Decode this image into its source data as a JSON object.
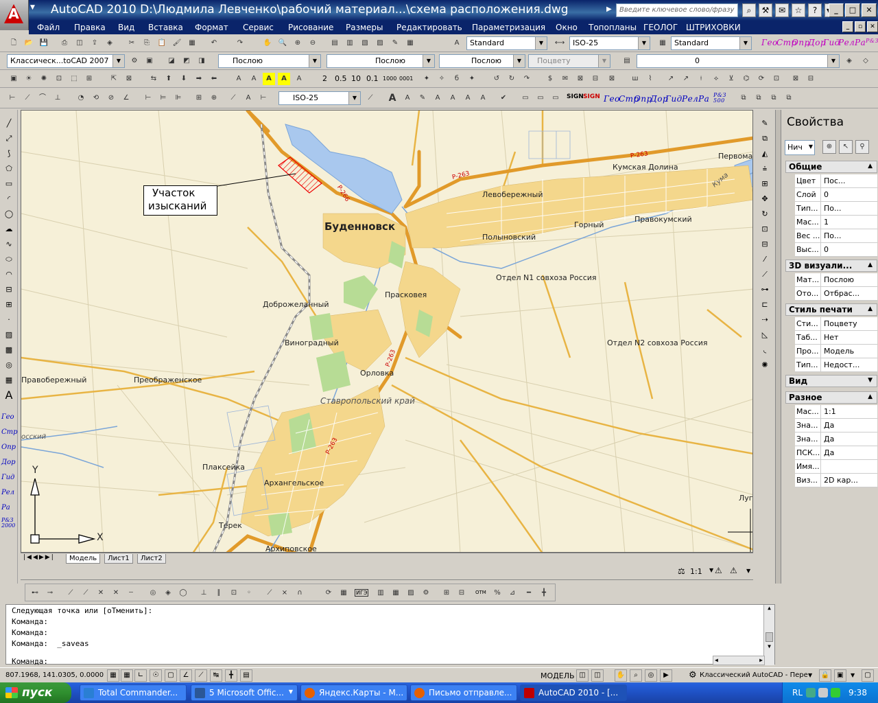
{
  "window": {
    "title": "AutoCAD 2010   D:\\Людмила Левченко\\рабочий материал...\\схема расположения.dwg",
    "search_placeholder": "Введите ключевое слово/фразу"
  },
  "menu": [
    "Файл",
    "Правка",
    "Вид",
    "Вставка",
    "Формат",
    "Сервис",
    "Рисование",
    "Размеры",
    "Редактировать",
    "Параметризация",
    "Окно",
    "Топопланы",
    "ГЕОЛОГ",
    "ШТРИХОВКИ"
  ],
  "toolbar_styles": {
    "text_style": "Standard",
    "dim_style": "ISO-25",
    "table_style": "Standard",
    "geo_labels": [
      "Гео",
      "Стр",
      "Опр",
      "Дор",
      "Гид",
      "Рел",
      "Ра",
      "Р&З"
    ]
  },
  "toolbar_props": {
    "workspace": "Классическ...toCAD 2007",
    "color": "Послою",
    "linetype": "Послою",
    "lineweight": "Послою",
    "plotstyle": "Поцвету",
    "layer": "0"
  },
  "toolbar_dims": {
    "dim_style": "ISO-25",
    "scales": [
      "2",
      "0.5",
      "10",
      "0.1",
      "1000",
      "0001"
    ],
    "sign_labels": [
      "SIGN",
      "SIGN"
    ],
    "geo_labels": [
      "Гео",
      "Стр",
      "Опр",
      "Дор",
      "Гид",
      "Рел",
      "Ра",
      "Р&З 500"
    ]
  },
  "left_geo": [
    "Гео",
    "Стр",
    "Опр",
    "Дор",
    "Гид",
    "Рел",
    "Ра",
    "Р&З 2000"
  ],
  "map": {
    "callout": [
      "Участок",
      "изысканий"
    ],
    "towns": [
      {
        "name": "Буденновск",
        "big": true
      },
      {
        "name": "Кумская Долина"
      },
      {
        "name": "Первома"
      },
      {
        "name": "Левобережный"
      },
      {
        "name": "Горный"
      },
      {
        "name": "Правокумский"
      },
      {
        "name": "Полыновский"
      },
      {
        "name": "Отдел N1 совхоза Россия"
      },
      {
        "name": "Доброжеланный"
      },
      {
        "name": "Прасковея"
      },
      {
        "name": "Виноградный"
      },
      {
        "name": "Отдел N2 совхоза Россия"
      },
      {
        "name": "Правобережный"
      },
      {
        "name": "Преображенское"
      },
      {
        "name": "Орловка"
      },
      {
        "name": "Ставропольский край",
        "italic": true
      },
      {
        "name": "Плаксейка"
      },
      {
        "name": "Архангельское"
      },
      {
        "name": "Терек"
      },
      {
        "name": "Архиповское"
      },
      {
        "name": "Луг"
      },
      {
        "name": "Кума"
      },
      {
        "name": "осский"
      }
    ],
    "roads": [
      "Р-263",
      "Р-263",
      "Р-266",
      "Р-263",
      "Р-263"
    ],
    "ucs": {
      "x": "X",
      "y": "Y"
    }
  },
  "layout_tabs": [
    "Модель",
    "Лист1",
    "Лист2"
  ],
  "annotation_scale": "1:1",
  "properties": {
    "title": "Свойства",
    "selection": "Нич",
    "sections": [
      {
        "name": "Общие",
        "expanded": true,
        "rows": [
          {
            "k": "Цвет",
            "v": "Пос..."
          },
          {
            "k": "Слой",
            "v": "0"
          },
          {
            "k": "Тип...",
            "v": "По..."
          },
          {
            "k": "Мас...",
            "v": "1"
          },
          {
            "k": "Вес ...",
            "v": "По..."
          },
          {
            "k": "Выс...",
            "v": "0"
          }
        ]
      },
      {
        "name": "3D визуали...",
        "expanded": true,
        "rows": [
          {
            "k": "Мат...",
            "v": "Послою"
          },
          {
            "k": "Ото...",
            "v": "Отбрас..."
          }
        ]
      },
      {
        "name": "Стиль печати",
        "expanded": true,
        "rows": [
          {
            "k": "Сти...",
            "v": "Поцвету"
          },
          {
            "k": "Таб...",
            "v": "Нет"
          },
          {
            "k": "Про...",
            "v": "Модель"
          },
          {
            "k": "Тип...",
            "v": "Недост..."
          }
        ]
      },
      {
        "name": "Вид",
        "expanded": false,
        "rows": []
      },
      {
        "name": "Разное",
        "expanded": true,
        "rows": [
          {
            "k": "Мас...",
            "v": "1:1"
          },
          {
            "k": "Зна...",
            "v": "Да"
          },
          {
            "k": "Зна...",
            "v": "Да"
          },
          {
            "k": "ПСК...",
            "v": "Да"
          },
          {
            "k": "Имя...",
            "v": ""
          },
          {
            "k": "Виз...",
            "v": "2D кар..."
          }
        ]
      }
    ]
  },
  "bottom_toolbar_labels": [
    "ИГЭ",
    "ОТМ"
  ],
  "command": {
    "history": [
      "Следующая точка или [оТменить]:",
      "Команда:",
      "Команда:",
      "Команда:  _saveas"
    ],
    "prompt": "Команда:"
  },
  "status": {
    "coords": "807.1968, 141.0305, 0.0000",
    "model": "МОДЕЛЬ",
    "workspace": "Классический AutoCAD - Пере"
  },
  "taskbar": {
    "start": "пуск",
    "tasks": [
      {
        "label": "Total Commander...",
        "color": "#2a7fd4"
      },
      {
        "label": "5 Microsoft Offic...",
        "color": "#2b5797"
      },
      {
        "label": "Яндекс.Карты - М...",
        "color": "#e66000"
      },
      {
        "label": "Письмо отправле...",
        "color": "#e66000"
      },
      {
        "label": "AutoCAD 2010 - [...",
        "color": "#c00000"
      }
    ],
    "lang": "RL",
    "clock": "9:38"
  }
}
